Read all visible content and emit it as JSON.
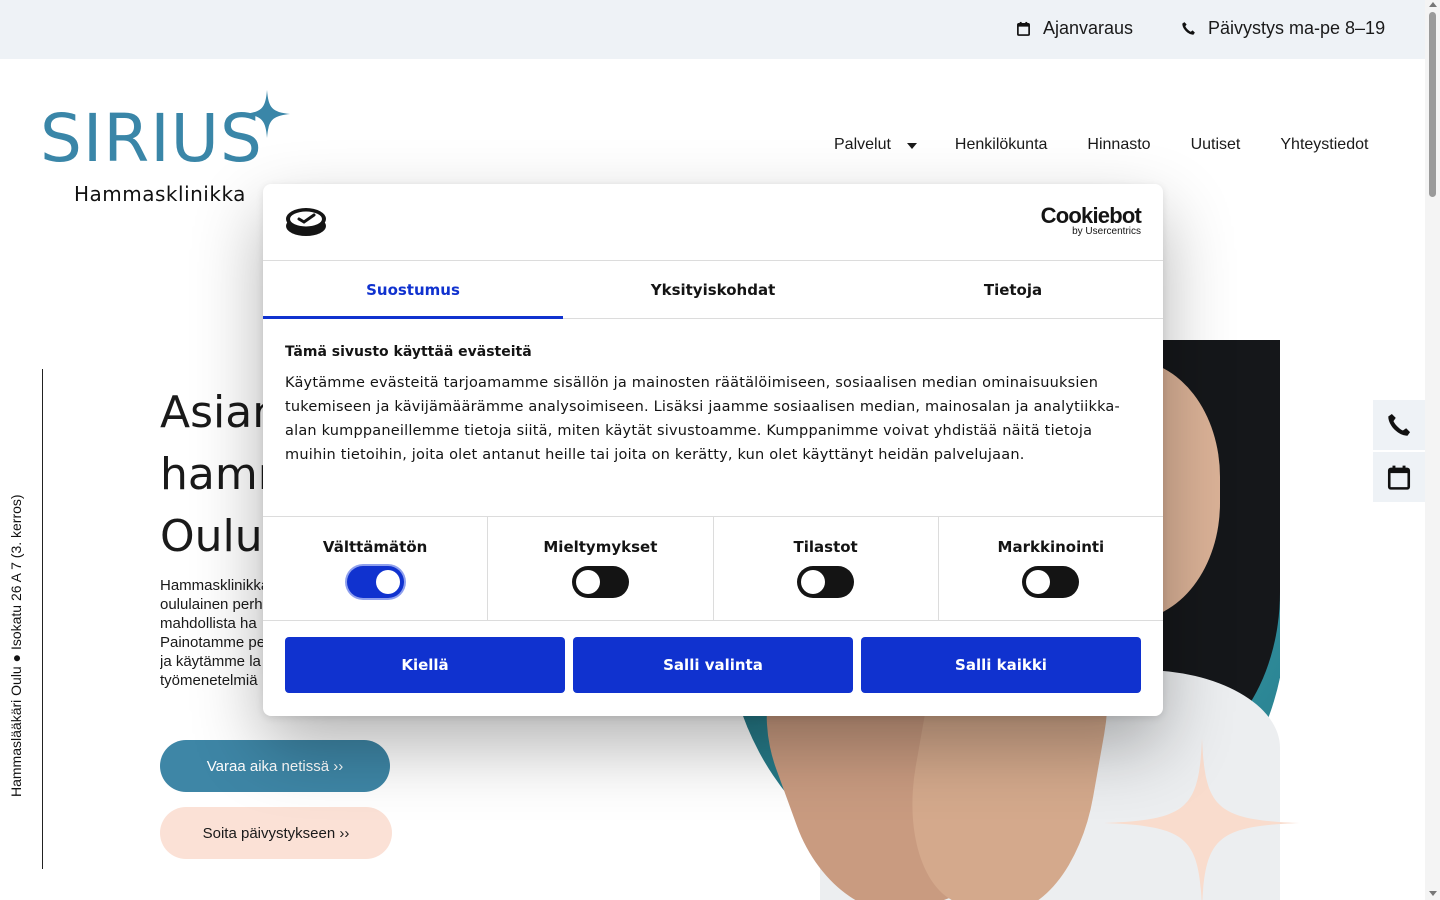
{
  "topbar": {
    "booking_label": "Ajanvaraus",
    "phone_label": "Päivystys ma-pe 8–19"
  },
  "logo": {
    "wordmark": "SIRIUS",
    "subtitle": "Hammasklinikka",
    "color": "#3a86a8"
  },
  "nav": {
    "items": [
      {
        "label": "Palvelut",
        "has_dropdown": true
      },
      {
        "label": "Henkilökunta"
      },
      {
        "label": "Hinnasto"
      },
      {
        "label": "Uutiset"
      },
      {
        "label": "Yhteystiedot"
      }
    ]
  },
  "side": {
    "address": "Hammaslääkäri Oulu ● Isokatu 26 A 7 (3. kerros)"
  },
  "hero": {
    "title_lines": [
      "Asian",
      "hamn",
      "Oulun"
    ],
    "body_lines": [
      "Hammasklinikka",
      "oululainen perh",
      "mahdollista ha",
      "Painotamme pe",
      "ja käytämme la",
      "työmenetelmiä"
    ],
    "primary_button": "Varaa aika netissä ››",
    "secondary_button": "Soita päivystykseen ››",
    "accent_color": "#3e86a6",
    "secondary_color": "#fbe1d6"
  },
  "floating": {
    "phone_icon": "phone-icon",
    "calendar_icon": "calendar-icon"
  },
  "cookie": {
    "brand": "Cookiebot",
    "brand_sub": "by Usercentrics",
    "tabs": [
      {
        "label": "Suostumus",
        "active": true
      },
      {
        "label": "Yksityiskohdat",
        "active": false
      },
      {
        "label": "Tietoja",
        "active": false
      }
    ],
    "title": "Tämä sivusto käyttää evästeitä",
    "text": "Käytämme evästeitä tarjoamamme sisällön ja mainosten räätälöimiseen, sosiaalisen median ominaisuuksien tukemiseen ja kävijämäärämme analysoimiseen. Lisäksi jaamme sosiaalisen median, mainosalan ja analytiikka-alan kumppaneillemme tietoja siitä, miten käytät sivustoamme. Kumppanimme voivat yhdistää näitä tietoja muihin tietoihin, joita olet antanut heille tai joita on kerätty, kun olet käyttänyt heidän palvelujaan.",
    "toggles": [
      {
        "label": "Välttämätön",
        "on": true
      },
      {
        "label": "Mieltymykset",
        "on": false
      },
      {
        "label": "Tilastot",
        "on": false
      },
      {
        "label": "Markkinointi",
        "on": false
      }
    ],
    "buttons": {
      "deny": "Kiellä",
      "allow_selection": "Salli valinta",
      "allow_all": "Salli kaikki"
    },
    "accent_color": "#1032cf"
  }
}
